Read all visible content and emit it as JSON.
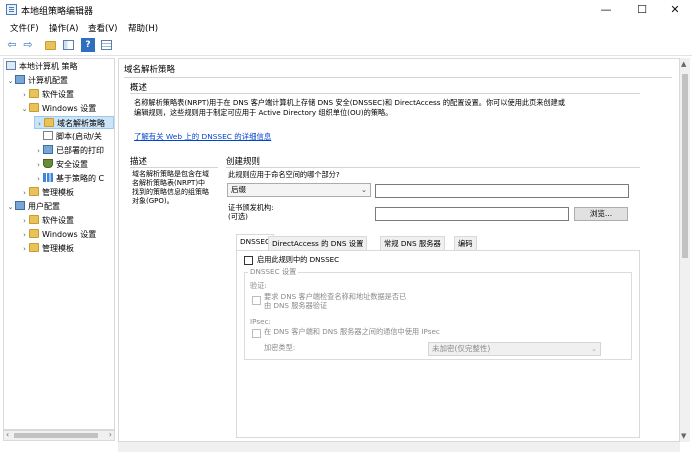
{
  "window": {
    "title": "本地组策略编辑器",
    "minimize_glyph": "—",
    "maximize_glyph": "☐",
    "close_glyph": "✕"
  },
  "menu": [
    "文件(F)",
    "操作(A)",
    "查看(V)",
    "帮助(H)"
  ],
  "toolbar": {
    "icons": [
      "back-arrow-icon",
      "forward-arrow-icon",
      "up-folder-icon",
      "show-hide-tree-icon",
      "help-icon",
      "properties-icon"
    ],
    "back": "⇦",
    "forward": "⇨",
    "help": "?"
  },
  "tree": {
    "root": "本地计算机 策略",
    "computer_config": "计算机配置",
    "software_settings": "软件设置",
    "windows_settings": "Windows 设置",
    "name_resolution_policy": "域名解析策略",
    "scripts": "脚本(启动/关",
    "printers": "已部署的打印",
    "security_settings": "安全设置",
    "policy_qos": "基于策略的 C",
    "admin_templates": "管理模板",
    "user_config": "用户配置",
    "user_software_settings": "软件设置",
    "user_windows_settings": "Windows 设置",
    "user_admin_templates": "管理模板",
    "expand_glyph": "›",
    "expanded_glyph": "⌄"
  },
  "right": {
    "header": "域名解析策略",
    "overview_title": "概述",
    "overview_line1": "名称解析策略表(NRPT)用于在 DNS 客户端计算机上存储 DNS 安全(DNSSEC)和 DirectAccess 的配置设置。你可以使用此页来创建或",
    "overview_line2": "编辑规则，这些规则用于制定可应用于 Active Directory 组织单位(OU)的策略。",
    "learn_more_link": "了解有关 Web 上的 DNSSEC 的详细信息",
    "description_title": "描述",
    "description_text": "域名解析策略是包含在域名解析策略表(NRPT)中找到的策略信息的组策略对象(GPO)。",
    "create_rules_title": "创建规则",
    "namespace_question": "此规则应用于命名空间的哪个部分?",
    "namespace_select": "后缀",
    "namespace_value": "",
    "cert_authority_label": "证书颁发机构:",
    "cert_authority_optional": "(可选)",
    "cert_authority_value": "",
    "browse_button": "浏览...",
    "tabs": [
      "DNSSEC",
      "DirectAccess 的 DNS 设置",
      "常规 DNS 服务器",
      "编码"
    ],
    "enable_dnssec_label": "启用此规则中的 DNSSEC",
    "dnssec_settings_title": "DNSSEC 设置",
    "validation_title": "验证:",
    "validation_line1": "要求 DNS 客户端检查名称和地址数据是否已",
    "validation_line2": "由 DNS 服务器验证",
    "ipsec_title": "IPsec:",
    "ipsec_label": "在 DNS 客户端和 DNS 服务器之间的通信中使用 IPsec",
    "encryption_type_label": "加密类型:",
    "encryption_type_value": "未加密(仅完整性)"
  }
}
